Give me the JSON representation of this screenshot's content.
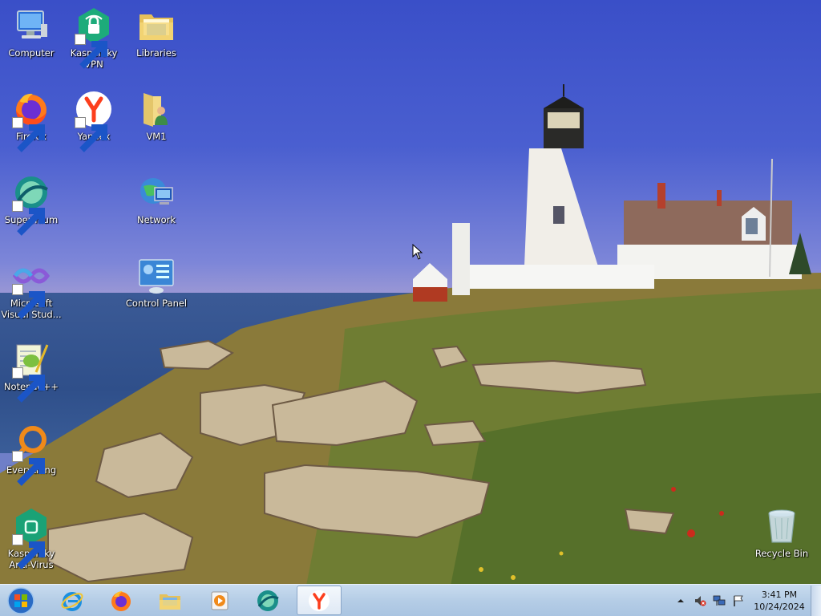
{
  "desktop_icons": [
    {
      "label": "Computer",
      "icon": "computer-icon"
    },
    {
      "label": "Kaspersky\nVPN",
      "icon": "kaspersky-vpn-icon"
    },
    {
      "label": "Libraries",
      "icon": "libraries-icon"
    },
    {
      "label": "Firefox",
      "icon": "firefox-icon"
    },
    {
      "label": "Yandex",
      "icon": "yandex-icon"
    },
    {
      "label": "VM1",
      "icon": "user-folder-icon"
    },
    {
      "label": "Supermium",
      "icon": "supermium-icon"
    },
    {
      "label": "Network",
      "icon": "network-icon"
    },
    {
      "label": "Microsoft\nVisual Stud...",
      "icon": "visual-studio-icon"
    },
    {
      "label": "Control Panel",
      "icon": "control-panel-icon"
    },
    {
      "label": "Notepad++",
      "icon": "notepadpp-icon"
    },
    {
      "label": "Everything",
      "icon": "everything-icon"
    },
    {
      "label": "Kaspersky\nAnti-Virus",
      "icon": "kaspersky-antivirus-icon"
    },
    {
      "label": "Recycle Bin",
      "icon": "recycle-bin-icon"
    }
  ],
  "taskbar": {
    "pinned": [
      "internet-explorer-icon",
      "firefox-icon",
      "file-explorer-icon",
      "media-player-icon",
      "supermium-icon",
      "yandex-icon"
    ],
    "active": "yandex-icon",
    "tray": [
      "show-hidden-icons-icon",
      "volume-muted-icon",
      "network-tray-icon",
      "action-center-flag-icon"
    ],
    "clock": {
      "time": "3:41 PM",
      "date": "10/24/2024"
    }
  }
}
